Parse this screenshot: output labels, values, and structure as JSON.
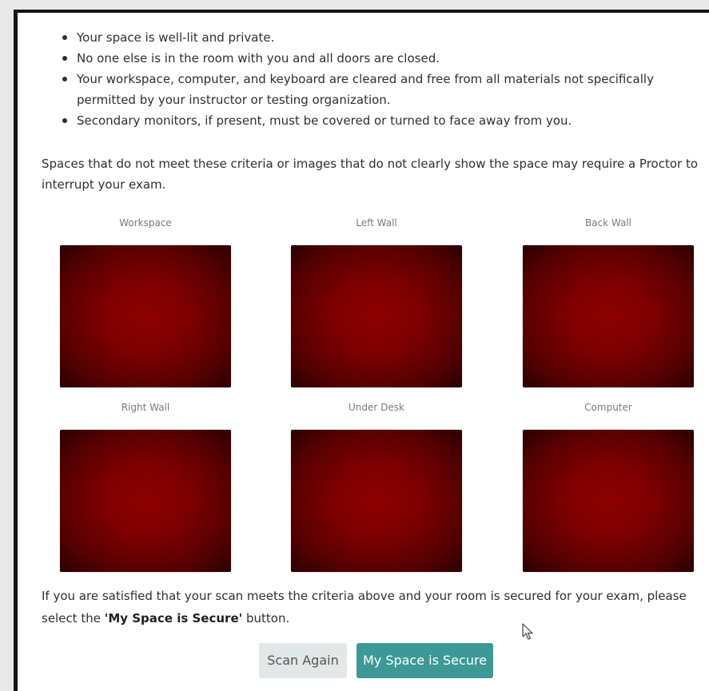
{
  "criteria": [
    "Your space is well-lit and private.",
    "No one else is in the room with you and all doors are closed.",
    "Your workspace, computer, and keyboard are cleared and free from all materials not specifically permitted by your instructor or testing organization.",
    "Secondary monitors, if present, must be covered or turned to face away from you."
  ],
  "note": "Spaces that do not meet these criteria or images that do not clearly show the space may require a Proctor to interrupt your exam.",
  "scans": [
    {
      "label": "Workspace"
    },
    {
      "label": "Left Wall"
    },
    {
      "label": "Back Wall"
    },
    {
      "label": "Right Wall"
    },
    {
      "label": "Under Desk"
    },
    {
      "label": "Computer"
    }
  ],
  "footer": {
    "text_before": "If you are satisfied that your scan meets the criteria above and your room is secured for your exam, please select the ",
    "bold": "'My Space is Secure'",
    "text_after": " button."
  },
  "buttons": {
    "scan_again": "Scan Again",
    "secure": "My Space is Secure"
  },
  "colors": {
    "secure_button": "#3c9997",
    "scan_again_button": "#e2e8e8",
    "scan_image_tint": "#8e0000"
  }
}
